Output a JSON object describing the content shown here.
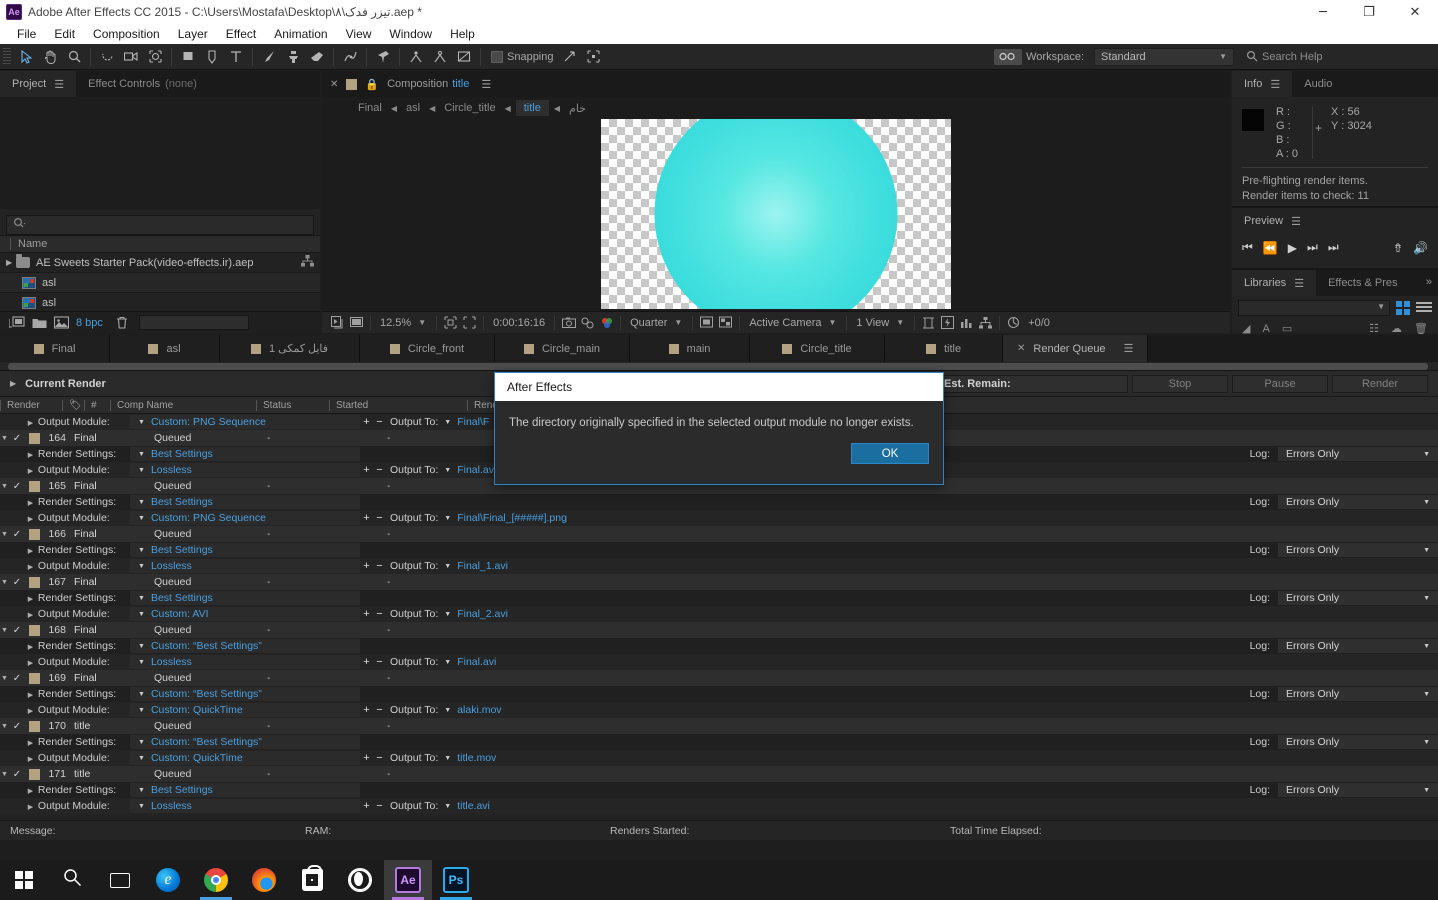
{
  "titlebar": {
    "app_icon": "ae-logo",
    "title": "Adobe After Effects CC 2015 - C:\\Users\\Mostafa\\Desktop\\۸\\تیزر فدک.aep *",
    "minimize": "─",
    "maximize": "❐",
    "close": "✕"
  },
  "menubar": {
    "items": [
      "File",
      "Edit",
      "Composition",
      "Layer",
      "Effect",
      "Animation",
      "View",
      "Window",
      "Help"
    ]
  },
  "toolbar": {
    "snapping_label": "Snapping",
    "workspace_label": "Workspace:",
    "workspace_value": "Standard",
    "search_placeholder": "Search Help"
  },
  "project_panel": {
    "tabs": [
      {
        "label": "Project",
        "active": true,
        "suffix": ""
      },
      {
        "label": "Effect Controls",
        "active": false,
        "suffix": "(none)"
      }
    ],
    "search_placeholder": "",
    "column_header": "Name",
    "rows": [
      {
        "name": "AE Sweets Starter Pack(video-effects.ir).aep",
        "type": "folder"
      },
      {
        "name": "asl",
        "type": "comp"
      },
      {
        "name": "asl",
        "type": "comp"
      }
    ],
    "footer": {
      "bpc": "8 bpc"
    }
  },
  "comp_panel": {
    "tab_title_prefix": "Composition",
    "tab_title_name": "title",
    "breadcrumb": [
      {
        "label": "Final",
        "active": false
      },
      {
        "label": "asl",
        "active": false
      },
      {
        "label": "Circle_title",
        "active": false
      },
      {
        "label": "title",
        "active": true
      },
      {
        "label": "خام",
        "active": false
      }
    ],
    "bottom_bar": {
      "zoom": "12.5%",
      "timecode": "0:00:16:16",
      "resolution": "Quarter",
      "camera": "Active Camera",
      "views": "1 View",
      "offset": "+0/0"
    }
  },
  "info_panel": {
    "tabs": [
      {
        "label": "Info",
        "active": true
      },
      {
        "label": "Audio",
        "active": false
      }
    ],
    "r_label": "R :",
    "g_label": "G :",
    "b_label": "B :",
    "a_label": "A :",
    "a_value": "0",
    "x_label": "X :",
    "x_value": "56",
    "y_label": "Y :",
    "y_value": "3024",
    "message_line1": "Pre-flighting render items.",
    "message_line2": "Render items to check: 11",
    "swatch_color": "#050505"
  },
  "preview_panel": {
    "title": "Preview",
    "buttons": [
      "first-frame",
      "prev-frame",
      "play",
      "next-frame",
      "last-frame",
      "export",
      "mute"
    ]
  },
  "libraries_panel": {
    "tabs": [
      {
        "label": "Libraries",
        "active": true
      },
      {
        "label": "Effects & Pres",
        "active": false
      }
    ],
    "overflow": "»"
  },
  "comp_strip": {
    "tabs": [
      {
        "label": "Final",
        "active": false,
        "closable": false
      },
      {
        "label": "asl",
        "active": false,
        "closable": false
      },
      {
        "label": "فایل کمکی 1",
        "active": false,
        "closable": false
      },
      {
        "label": "Circle_front",
        "active": false,
        "closable": false
      },
      {
        "label": "Circle_main",
        "active": false,
        "closable": false
      },
      {
        "label": "main",
        "active": false,
        "closable": false
      },
      {
        "label": "Circle_title",
        "active": false,
        "closable": false
      },
      {
        "label": "title",
        "active": false,
        "closable": false
      },
      {
        "label": "Render Queue",
        "active": true,
        "closable": true
      }
    ]
  },
  "render_queue": {
    "current_render_label": "Current Render",
    "est_remain_label": "Est. Remain:",
    "buttons": {
      "stop": "Stop",
      "pause": "Pause",
      "render": "Render"
    },
    "columns": [
      "Render",
      "#",
      "Comp Name",
      "Status",
      "Started",
      "Render T"
    ],
    "tag_column_icon": "tag-icon",
    "sub_labels": {
      "render_settings": "Render Settings:",
      "output_module": "Output Module:",
      "log": "Log:",
      "output_to": "Output To:"
    },
    "top_partial_row": {
      "label": "Output Module:",
      "value": "Custom: PNG Sequence",
      "output_to": "Final\\F"
    },
    "items": [
      {
        "num": "164",
        "comp": "Final",
        "status": "Queued",
        "started": "-",
        "render_time": "-",
        "render_settings": "Best Settings",
        "log": "Errors Only",
        "output_module": "Lossless",
        "output_to": "Final.avi"
      },
      {
        "num": "165",
        "comp": "Final",
        "status": "Queued",
        "started": "-",
        "render_time": "-",
        "render_settings": "Best Settings",
        "log": "Errors Only",
        "output_module": "Custom: PNG Sequence",
        "output_to": "Final\\Final_[#####].png"
      },
      {
        "num": "166",
        "comp": "Final",
        "status": "Queued",
        "started": "-",
        "render_time": "-",
        "render_settings": "Best Settings",
        "log": "Errors Only",
        "output_module": "Lossless",
        "output_to": "Final_1.avi"
      },
      {
        "num": "167",
        "comp": "Final",
        "status": "Queued",
        "started": "-",
        "render_time": "-",
        "render_settings": "Best Settings",
        "log": "Errors Only",
        "output_module": "Custom: AVI",
        "output_to": "Final_2.avi"
      },
      {
        "num": "168",
        "comp": "Final",
        "status": "Queued",
        "started": "-",
        "render_time": "-",
        "render_settings": "Custom: “Best Settings”",
        "log": "Errors Only",
        "output_module": "Lossless",
        "output_to": "Final.avi"
      },
      {
        "num": "169",
        "comp": "Final",
        "status": "Queued",
        "started": "-",
        "render_time": "-",
        "render_settings": "Custom: “Best Settings”",
        "log": "Errors Only",
        "output_module": "Custom: QuickTime",
        "output_to": "alaki.mov"
      },
      {
        "num": "170",
        "comp": "title",
        "status": "Queued",
        "started": "-",
        "render_time": "-",
        "render_settings": "Custom: “Best Settings”",
        "log": "Errors Only",
        "output_module": "Custom: QuickTime",
        "output_to": "title.mov"
      },
      {
        "num": "171",
        "comp": "title",
        "status": "Queued",
        "started": "-",
        "render_time": "-",
        "render_settings": "Best Settings",
        "log": "Errors Only",
        "output_module": "Lossless",
        "output_to": "title.avi"
      }
    ],
    "status_bar": {
      "message": "Message:",
      "ram": "RAM:",
      "renders_started": "Renders Started:",
      "total_time": "Total Time Elapsed:"
    }
  },
  "dialog": {
    "title": "After Effects",
    "message": "The directory originally specified in the selected output module no longer exists.",
    "ok_label": "OK",
    "accent": "#1b6ea0",
    "border": "#2a85c9"
  },
  "taskbar": {
    "items": [
      {
        "name": "start-button",
        "icon": "windows-logo"
      },
      {
        "name": "search-button",
        "icon": "search-icon"
      },
      {
        "name": "task-view-button",
        "icon": "task-view-icon"
      },
      {
        "name": "edge-button",
        "icon": "edge-icon",
        "label": "e"
      },
      {
        "name": "chrome-button",
        "icon": "chrome-icon"
      },
      {
        "name": "firefox-button",
        "icon": "firefox-icon"
      },
      {
        "name": "store-button",
        "icon": "store-icon"
      },
      {
        "name": "opera-button",
        "icon": "opera-icon"
      },
      {
        "name": "after-effects-button",
        "icon": "ae-icon",
        "label": "Ae",
        "active": true
      },
      {
        "name": "photoshop-button",
        "icon": "ps-icon",
        "label": "Ps"
      }
    ]
  }
}
